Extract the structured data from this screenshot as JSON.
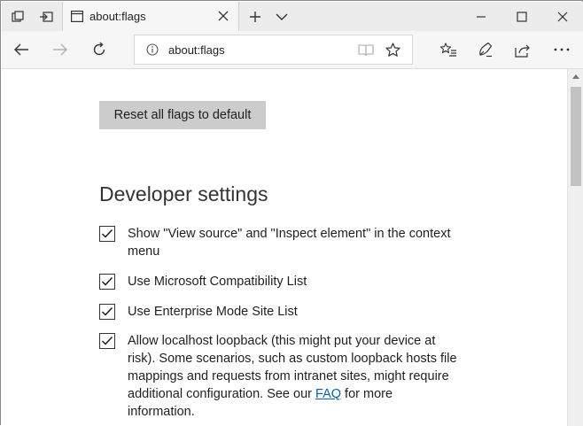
{
  "window": {
    "tab_title": "about:flags",
    "controls": {
      "minimize": "—",
      "maximize": "☐",
      "close": "✕"
    }
  },
  "navbar": {
    "address": "about:flags",
    "icons": [
      "back-icon",
      "forward-icon",
      "refresh-icon",
      "info-icon",
      "reading-view-icon",
      "favorite-star-icon",
      "favorites-hub-icon",
      "web-note-icon",
      "share-icon",
      "more-icon"
    ]
  },
  "page": {
    "reset_button": "Reset all flags to default",
    "section_title": "Developer settings",
    "settings": [
      {
        "label": "Show \"View source\" and \"Inspect element\" in the context menu",
        "checked": true
      },
      {
        "label": "Use Microsoft Compatibility List",
        "checked": true
      },
      {
        "label": "Use Enterprise Mode Site List",
        "checked": true
      },
      {
        "label_before": "Allow localhost loopback (this might put your device at risk). Some scenarios, such as custom loopback hosts file mappings and requests from intranet sites, might require additional configuration. See our ",
        "link": "FAQ",
        "label_after": " for more information.",
        "checked": true
      }
    ]
  },
  "colors": {
    "accent_link": "#0063b1",
    "button_bg": "#cccccc",
    "chrome_bg": "#ececec"
  }
}
